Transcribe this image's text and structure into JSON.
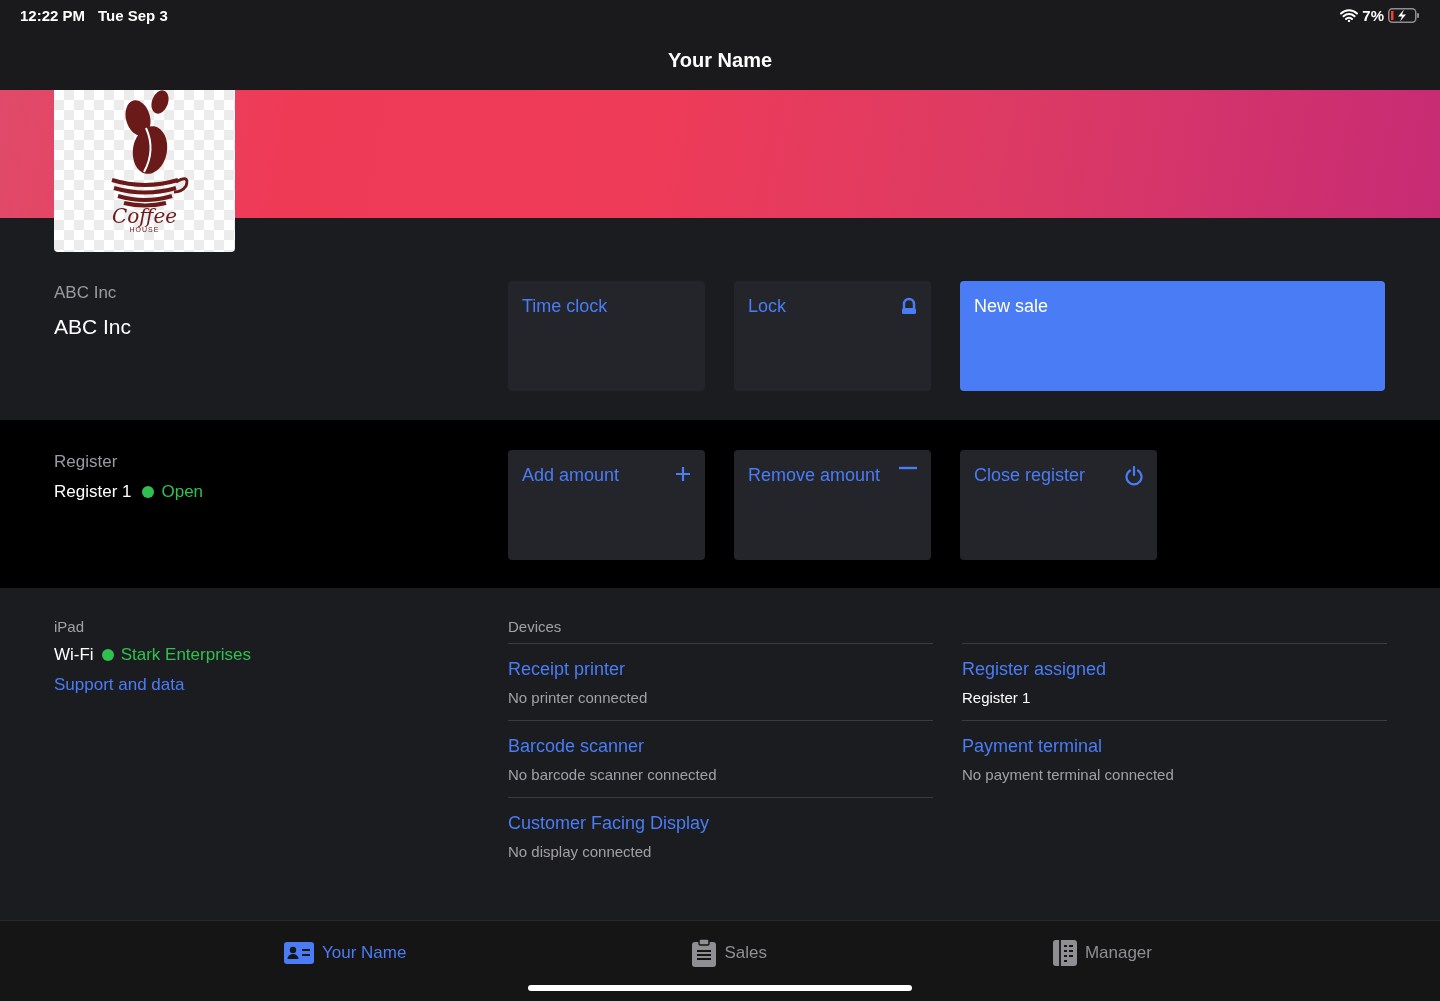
{
  "status_bar": {
    "time": "12:22 PM",
    "date": "Tue Sep 3",
    "battery": "7%"
  },
  "nav": {
    "title": "Your Name"
  },
  "logo": {
    "line_1": "Coffee",
    "line_2": "HOUSE"
  },
  "business": {
    "label": "ABC Inc",
    "name": "ABC Inc"
  },
  "business_actions": [
    {
      "label": "Time clock",
      "kind": "plain"
    },
    {
      "label": "Lock",
      "kind": "lock"
    },
    {
      "label": "New sale",
      "kind": "primary"
    }
  ],
  "register": {
    "label": "Register",
    "name": "Register 1",
    "status": "Open",
    "open": true
  },
  "register_actions": [
    {
      "label": "Add amount",
      "kind": "add"
    },
    {
      "label": "Remove amount",
      "kind": "remove"
    },
    {
      "label": "Close register",
      "kind": "power"
    }
  ],
  "device": {
    "label": "iPad",
    "network_label": "Wi-Fi",
    "network": "Stark Enterprises",
    "connected": true,
    "support_link": "Support and data"
  },
  "devices": {
    "heading": "Devices",
    "columns": [
      [
        {
          "title": "Receipt printer",
          "detail": "No printer connected",
          "connected": false
        },
        {
          "title": "Barcode scanner",
          "detail": "No barcode scanner connected",
          "connected": false
        },
        {
          "title": "Customer Facing Display",
          "detail": "No display connected",
          "connected": false
        }
      ],
      [
        {
          "title": "Register assigned",
          "detail": "Register 1",
          "connected": true
        },
        {
          "title": "Payment terminal",
          "detail": "No payment terminal connected",
          "connected": false
        }
      ]
    ]
  },
  "tabs": [
    {
      "label": "Your Name",
      "kind": "profile",
      "selected": true
    },
    {
      "label": "Sales",
      "kind": "clipboard",
      "selected": false
    },
    {
      "label": "Manager",
      "kind": "ledger",
      "selected": false
    }
  ]
}
